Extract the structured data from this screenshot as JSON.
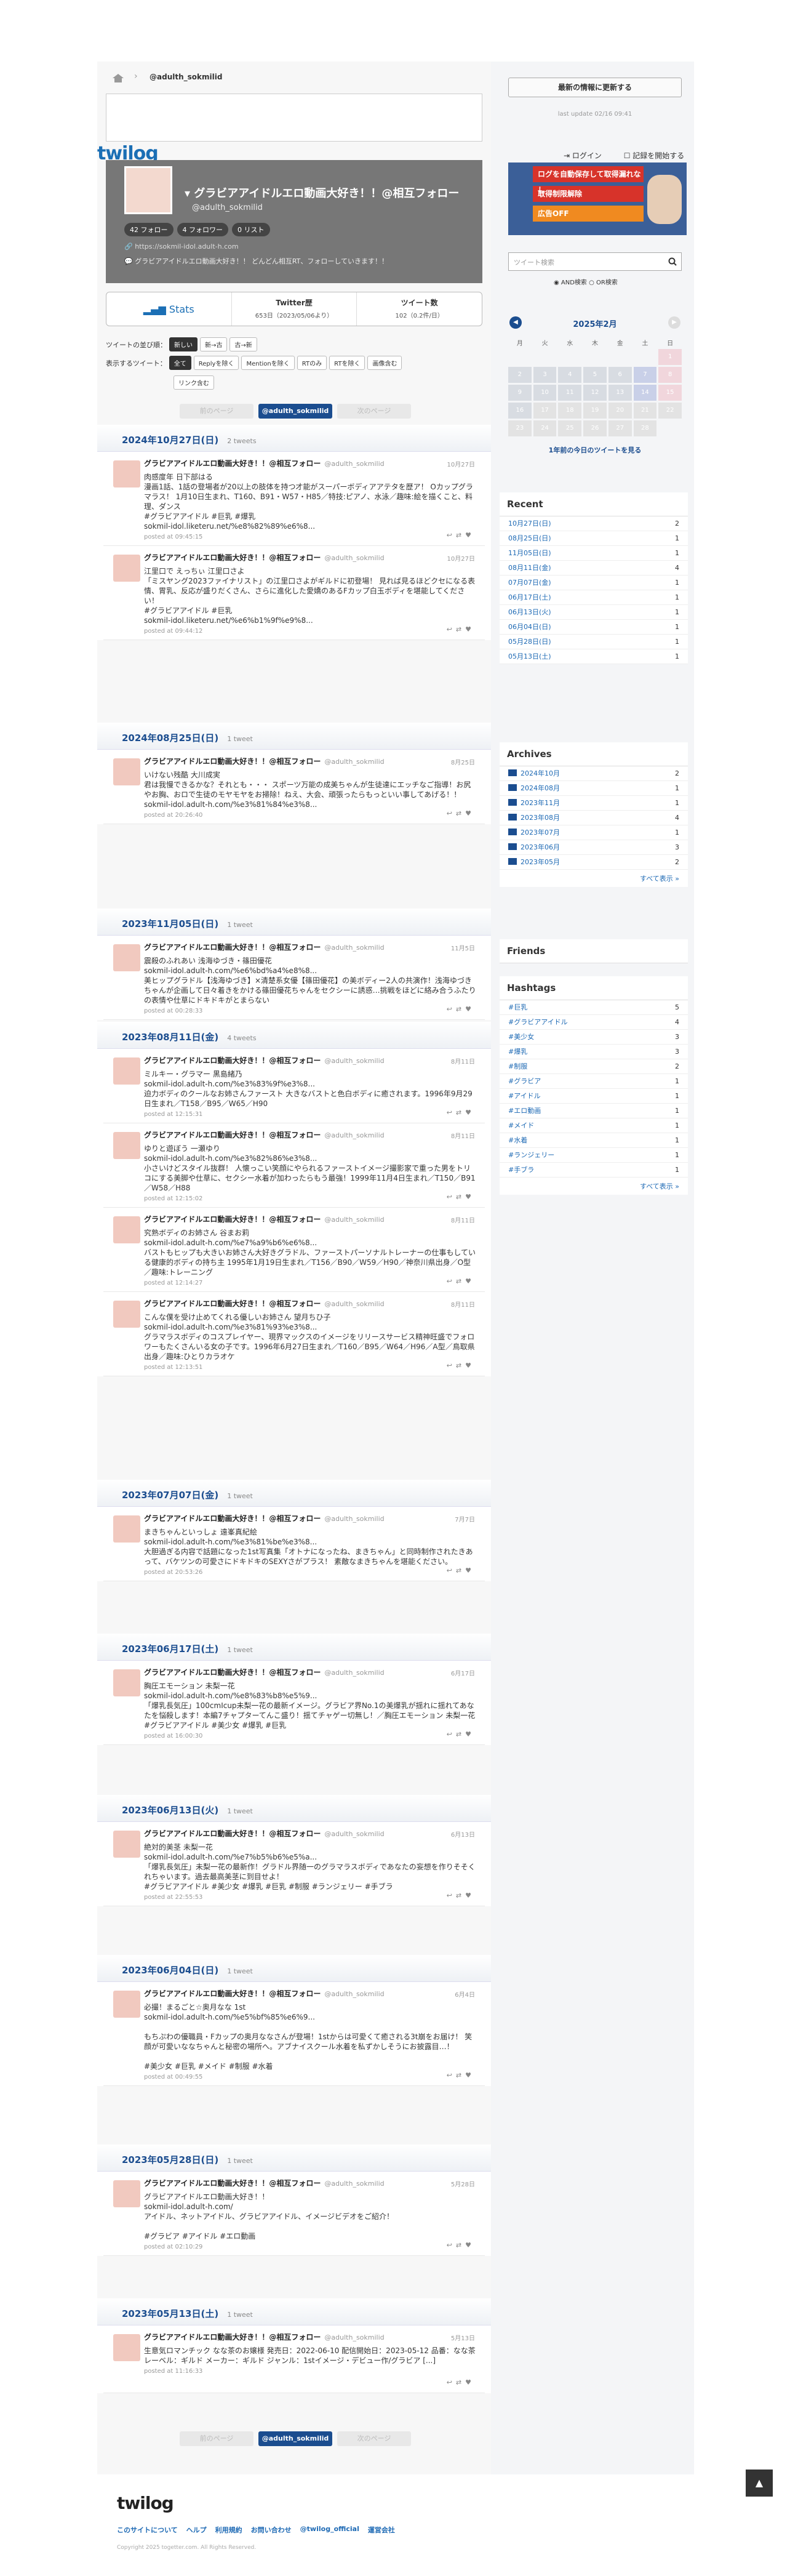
{
  "breadcrumb": {
    "handle": "@adulth_sokmilid"
  },
  "header": {
    "logo": "twilog",
    "login": "ログイン",
    "register": "記録を開始する"
  },
  "profile": {
    "name": "グラビアアイドルエロ動画大好き！！@相互フォロー",
    "handle": "@adulth_sokmilid",
    "follow": "42 フォロー",
    "follower": "4 フォロワー",
    "list": "0 リスト",
    "url": "https://sokmil-idol.adult-h.com",
    "desc": "グラビアアイドルエロ動画大好き！！ どんどん相互RT、フォローしていきます！！"
  },
  "stats": {
    "label": "Stats",
    "twitter_label": "Twitter歴",
    "twitter_val": "653日（2023/05/06より）",
    "tweets_label": "ツイート数",
    "tweets_val": "102（0.2件/日）"
  },
  "filters": {
    "order_label": "ツイートの並び順：",
    "order": [
      "新しい",
      "新→古",
      "古→新"
    ],
    "show_label": "表示するツイート：",
    "show": [
      "全て",
      "Replyを除く",
      "Mentionを除く",
      "RTのみ",
      "RTを除く",
      "画像含む",
      "リンク含む"
    ]
  },
  "pager": {
    "prev": "前のページ",
    "center": "@adulth_sokmilid",
    "next": "次のページ"
  },
  "days": [
    {
      "date": "2024年10月27日(日)",
      "count": "2 tweets",
      "tweets": [
        {
          "date": "10月27日",
          "text": "肉感度年 日下部はる\n漫画1話、1話の登場者が20以上の肢体を持つ才能がスーパーボディアアテタを歴ア！ Oカップグラマラス！ 1月10日生まれ、T160、B91・W57・H85／特技:ピアノ、水泳／趣味:絵を描くこと、料理、ダンス\n#グラビアアイドル #巨乳 #爆乳\nsokmil-idol.liketeru.net/%e8%82%89%e6%8...",
          "time": "posted at 09:45:15"
        },
        {
          "date": "10月27日",
          "text": "江里口で えっちぃ 江里口さよ\n「ミスヤング2023ファイナリスト」の江里口さよがギルドに初登場！ 見れば見るほどクセになる表情、胃乳、反応が盛りだくさん、さらに進化した愛嬌のあるFカップ白玉ボディを堪能してください！\n#グラビアアイドル #巨乳\nsokmil-idol.liketeru.net/%e6%b1%9f%e9%8...",
          "time": "posted at 09:44:12"
        }
      ]
    },
    {
      "date": "2024年08月25日(日)",
      "count": "1 tweet",
      "tweets": [
        {
          "date": "8月25日",
          "text": "いけない残酷 大川成実\n君は我慢できるかな？それとも・・・ スポーツ万能の成美ちゃんが生徒達にエッチなご指導！お尻やお胸、おロで生徒のモヤモヤをお掃除！ねえ、大会、頑張ったらもっといい事してあげる！！\nsokmil-idol.adult-h.com/%e3%81%84%e3%8...",
          "time": "posted at 20:26:40"
        }
      ]
    },
    {
      "date": "2023年11月05日(日)",
      "count": "1 tweet",
      "tweets": [
        {
          "date": "11月5日",
          "text": "震殺のふれあい 浅海ゆづき・篠田優花\nsokmil-idol.adult-h.com/%e6%bd%a4%e8%8...\n美ヒップグラドル【浅海ゆづき】×清楚系女優【篠田優花】の美ボディー2人の共演作！浅海ゆづきちゃんが企画して日々着きをかける篠田優花ちゃんをセクシーに誘惑…挑戦をほどに絡み合うふたりの表情や仕草にドキドキがとまらない",
          "time": "posted at 00:28:33"
        }
      ]
    },
    {
      "date": "2023年08月11日(金)",
      "count": "4 tweets",
      "tweets": [
        {
          "date": "8月11日",
          "text": "ミルキー・グラマー 黒島緒乃\nsokmil-idol.adult-h.com/%e3%83%9f%e3%8...\n迫力ボディのクールなお姉さんファースト 大きなバストと色白ボディに癒されます。1996年9月29日生まれ／T158／B95／W65／H90",
          "time": "posted at 12:15:31"
        },
        {
          "date": "8月11日",
          "text": "ゆりと遊ぼう 一瀬ゆり\nsokmil-idol.adult-h.com/%e3%82%86%e3%8...\n小さいけどスタイル抜群！ 人懐っこい笑顔にやられるファーストイメージ撮影家で重った男をトリコにする美脚や仕草に、セクシー水着が加わったらもう最強！1999年11月4日生まれ／T150／B91／W58／H88",
          "time": "posted at 12:15:02"
        },
        {
          "date": "8月11日",
          "text": "究熟ボディのお姉さん 谷まお莉\nsokmil-idol.adult-h.com/%e7%a9%b6%e6%8...\nバストもヒップも大きいお姉さん大好きグラドル、ファーストパーソナルトレーナーの仕事もしている健康的ボディの持ち主 1995年1月19日生まれ／T156／B90／W59／H90／神奈川県出身／O型／趣味:トレーニング",
          "time": "posted at 12:14:27"
        },
        {
          "date": "8月11日",
          "text": "こんな僕を受け止めてくれる優しいお姉さん 望月ちひ子\nsokmil-idol.adult-h.com/%e3%81%93%e3%8...\nグラマラスボディのコスプレイヤー、現界マックスのイメージをリリースサービス精神旺盛でフォロワーもたくさんいる女の子です。1996年6月27日生まれ／T160／B95／W64／H96／A型／鳥取県出身／趣味:ひとりカラオケ",
          "time": "posted at 12:13:51"
        }
      ]
    },
    {
      "date": "2023年07月07日(金)",
      "count": "1 tweet",
      "tweets": [
        {
          "date": "7月7日",
          "text": "まきちゃんといっしょ 遠峯真紀絵\nsokmil-idol.adult-h.com/%e3%81%be%e3%8...\n大胆過ぎる内容で話題になった1st写真集「オトナになったね、まきちゃん」と同時制作されたきあって、バケツンの可愛さにドキドキのSEXYさがプラス！ 素敵なまきちゃんを堪能ください。",
          "time": "posted at 20:53:26"
        }
      ]
    },
    {
      "date": "2023年06月17日(土)",
      "count": "1 tweet",
      "tweets": [
        {
          "date": "6月17日",
          "text": "胸圧エモーション 未梨一花\nsokmil-idol.adult-h.com/%e8%83%b8%e5%9...\n「爆乳長気圧」100cmIcup未梨一花の最新イメージ。グラビア界No.1の美爆乳が揺れに揺れてあなたを悩殺します！本編7チャプターてんこ盛り！揺てチャゲー切無し！／胸圧エモーション 未梨一花\n#グラビアアイドル #美少女 #爆乳 #巨乳",
          "time": "posted at 16:00:30"
        }
      ]
    },
    {
      "date": "2023年06月13日(火)",
      "count": "1 tweet",
      "tweets": [
        {
          "date": "6月13日",
          "text": "絶対的美茎 未梨一花\nsokmil-idol.adult-h.com/%e7%b5%b6%e5%a...\n「爆乳長気圧」未梨一花の最新作！グラドル界随一のグラマラスボディであなたの妄想を作りそそくれちゃいます。過去最高美茎に到目せよ！\n#グラビアアイドル #美少女 #爆乳 #巨乳 #制服 #ランジェリー #手ブラ",
          "time": "posted at 22:55:53"
        }
      ]
    },
    {
      "date": "2023年06月04日(日)",
      "count": "1 tweet",
      "tweets": [
        {
          "date": "6月4日",
          "text": "必撮！まるごと☆奥月なな 1st\nsokmil-idol.adult-h.com/%e5%bf%85%e6%9...\n\nもちぷわの優職員・Fカップの奥月ななさんが登場！1stからは可愛くて癒される3t崩をお届け！ 笑顔が可愛いななちゃんと秘密の場所へ。アブナイスクール水着を私ずかしそうにお披露目…！\n\n#美少女 #巨乳 #メイド #制服 #水着",
          "time": "posted at 00:49:55"
        }
      ]
    },
    {
      "date": "2023年05月28日(日)",
      "count": "1 tweet",
      "tweets": [
        {
          "date": "5月28日",
          "text": "グラビアアイドルエロ動画大好き！！\nsokmil-idol.adult-h.com/\nアイドル、ネットアイドル、グラビアアイドル、イメージビデオをご紹介！\n\n#グラビア #アイドル #エロ動画",
          "time": "posted at 02:10:29"
        }
      ]
    },
    {
      "date": "2023年05月13日(土)",
      "count": "1 tweet",
      "tweets": [
        {
          "date": "5月13日",
          "text": "生意気ロマンチック なな茶のお嬢様 発売日：2022-06-10 配信開始日：2023-05-12 品番：なな茶 レーベル：ギルド メーカー：ギルド ジャンル：1stイメージ・デビュー作/グラビア [...]",
          "time": "posted at 11:16:33"
        }
      ]
    }
  ],
  "tweet_author": {
    "name": "グラビアアイドルエロ動画大好き！！@相互フォロー",
    "handle": "@adulth_sokmilid"
  },
  "side": {
    "update_btn": "最新の情報に更新する",
    "last_update": "last update 02/16 09:41",
    "ads": [
      "ログを自動保存して取得漏れなし",
      "取得制限解除",
      "広告OFF"
    ],
    "search_placeholder": "ツイート検索",
    "search_and": "AND検索",
    "search_or": "OR検索",
    "cal_title": "2025年2月",
    "weekdays": [
      "月",
      "火",
      "水",
      "木",
      "金",
      "土",
      "日"
    ],
    "year_ago": "1年前の今日のツイートを見る",
    "recent_title": "Recent",
    "recent": [
      {
        "label": "10月27日(日)",
        "n": "2"
      },
      {
        "label": "08月25日(日)",
        "n": "1"
      },
      {
        "label": "11月05日(日)",
        "n": "1"
      },
      {
        "label": "08月11日(金)",
        "n": "4"
      },
      {
        "label": "07月07日(金)",
        "n": "1"
      },
      {
        "label": "06月17日(土)",
        "n": "1"
      },
      {
        "label": "06月13日(火)",
        "n": "1"
      },
      {
        "label": "06月04日(日)",
        "n": "1"
      },
      {
        "label": "05月28日(日)",
        "n": "1"
      },
      {
        "label": "05月13日(土)",
        "n": "1"
      }
    ],
    "archives_title": "Archives",
    "archives": [
      {
        "label": "2024年10月",
        "n": "2"
      },
      {
        "label": "2024年08月",
        "n": "1"
      },
      {
        "label": "2023年11月",
        "n": "1"
      },
      {
        "label": "2023年08月",
        "n": "4"
      },
      {
        "label": "2023年07月",
        "n": "1"
      },
      {
        "label": "2023年06月",
        "n": "3"
      },
      {
        "label": "2023年05月",
        "n": "2"
      }
    ],
    "archives_more": "すべて表示 »",
    "friends_title": "Friends",
    "hashtags_title": "Hashtags",
    "hashtags": [
      {
        "label": "#巨乳",
        "n": "5"
      },
      {
        "label": "#グラビアアイドル",
        "n": "4"
      },
      {
        "label": "#美少女",
        "n": "3"
      },
      {
        "label": "#爆乳",
        "n": "3"
      },
      {
        "label": "#制服",
        "n": "2"
      },
      {
        "label": "#グラビア",
        "n": "1"
      },
      {
        "label": "#アイドル",
        "n": "1"
      },
      {
        "label": "#エロ動画",
        "n": "1"
      },
      {
        "label": "#メイド",
        "n": "1"
      },
      {
        "label": "#水着",
        "n": "1"
      },
      {
        "label": "#ランジェリー",
        "n": "1"
      },
      {
        "label": "#手ブラ",
        "n": "1"
      }
    ],
    "hashtags_more": "すべて表示 »"
  },
  "footer": {
    "logo": "twilog",
    "links": [
      "このサイトについて",
      "ヘルプ",
      "利用規約",
      "お問い合わせ",
      "@twilog_official",
      "運営会社"
    ],
    "copyright": "Copyright 2025 togetter.com. All Rights Reserved."
  },
  "colors": {
    "accent": "#1b4d8f",
    "link": "#1d69b4"
  }
}
